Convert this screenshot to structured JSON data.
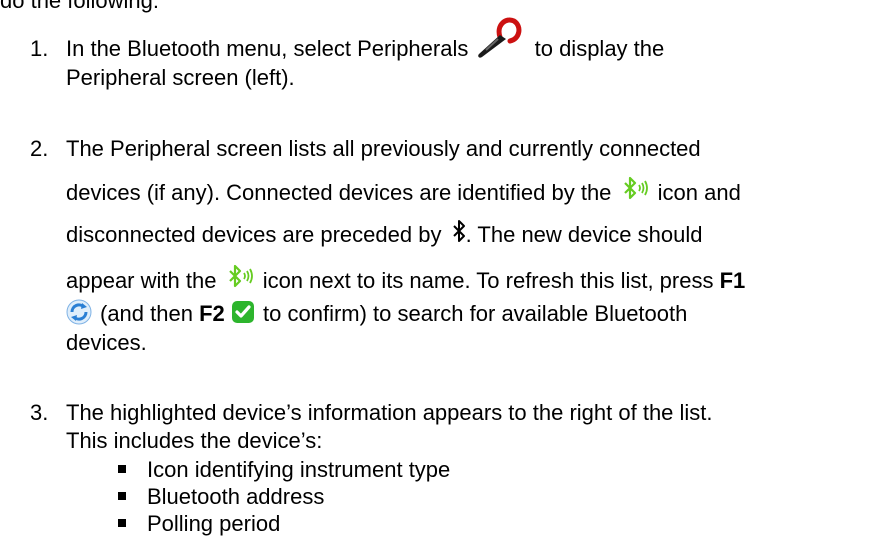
{
  "intro": {
    "text": "do the following:"
  },
  "steps": [
    {
      "number": "1.",
      "line1_before": "In the Bluetooth menu, select Peripherals",
      "line1_after": "to display the",
      "line2": "Peripheral screen (left).",
      "icon": "clamp-meter-icon"
    },
    {
      "number": "2.",
      "line1": "The Peripheral screen lists all previously and currently connected",
      "line2_a": "devices (if any). Connected devices are identified by the",
      "line2_b": "icon and",
      "line3_a": "disconnected devices are preceded by",
      "line3_b": ". The new device should",
      "line4_a": "appear with the",
      "line4_b": "icon next to its name. To refresh this list, press",
      "f1": "F1",
      "line5_a": "(and then",
      "f2": "F2",
      "line5_b": "to confirm) to search for available Bluetooth",
      "line6": "devices.",
      "icons": [
        "bluetooth-connected-icon",
        "bluetooth-disconnected-icon",
        "refresh-icon",
        "checkmark-icon"
      ]
    },
    {
      "number": "3.",
      "line1": "The highlighted device’s information appears to the right of the list.",
      "line2": "This includes the device’s:",
      "bullets": [
        "Icon identifying instrument type",
        "Bluetooth address",
        "Polling period"
      ]
    }
  ],
  "colors": {
    "bluetooth_connected": "#66cc22",
    "refresh": "#2a7fd4",
    "check": "#2db52d",
    "clamp_red": "#cc1111"
  }
}
